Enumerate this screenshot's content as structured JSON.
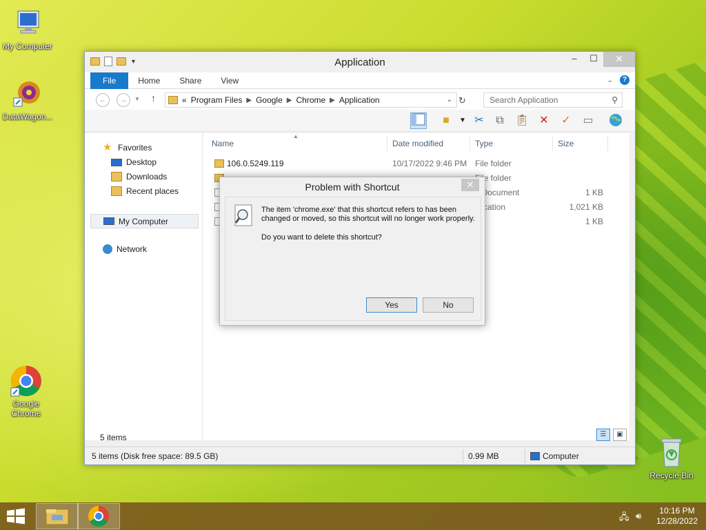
{
  "desktop": {
    "icons": [
      {
        "label": "My Computer",
        "icon": "computer-icon"
      },
      {
        "label": "DataWagon...",
        "icon": "datawagon-icon"
      },
      {
        "label": "Google Chrome",
        "icon": "chrome-icon"
      },
      {
        "label": "Recycle Bin",
        "icon": "recycle-bin-icon"
      }
    ]
  },
  "explorer": {
    "title": "Application",
    "ribbon_tabs": [
      "File",
      "Home",
      "Share",
      "View"
    ],
    "breadcrumb_overflow": "«",
    "breadcrumb": [
      "Program Files",
      "Google",
      "Chrome",
      "Application"
    ],
    "search_placeholder": "Search Application",
    "nav": {
      "favorites": "Favorites",
      "desktop": "Desktop",
      "downloads": "Downloads",
      "recent": "Recent places",
      "my_computer": "My Computer",
      "network": "Network"
    },
    "columns": {
      "name": "Name",
      "date": "Date modified",
      "type": "Type",
      "size": "Size"
    },
    "rows": [
      {
        "name": "106.0.5249.119",
        "date": "10/17/2022 9:46 PM",
        "type": "File folder",
        "size": ""
      },
      {
        "name": "",
        "date": "",
        "type": "File folder",
        "size": ""
      },
      {
        "name": "",
        "date": "",
        "type": "L Document",
        "size": "1 KB"
      },
      {
        "name": "",
        "date": "",
        "type": "plication",
        "size": "1,021 KB"
      },
      {
        "name": "",
        "date": "",
        "type": "e",
        "size": "1 KB"
      }
    ],
    "items_count": "5 items",
    "status": {
      "left": "5 items (Disk free space: 89.5 GB)",
      "size": "0.99 MB",
      "location": "Computer"
    }
  },
  "dialog": {
    "title": "Problem with Shortcut",
    "message": "The item 'chrome.exe' that this shortcut refers to has been changed or moved, so this shortcut will no longer work properly.",
    "question": "Do you want to delete this shortcut?",
    "yes": "Yes",
    "no": "No"
  },
  "taskbar": {
    "time": "10:16 PM",
    "date": "12/28/2022"
  },
  "colors": {
    "accent": "#1979ca",
    "taskbar": "#78541e",
    "folder": "#e8c15a"
  }
}
